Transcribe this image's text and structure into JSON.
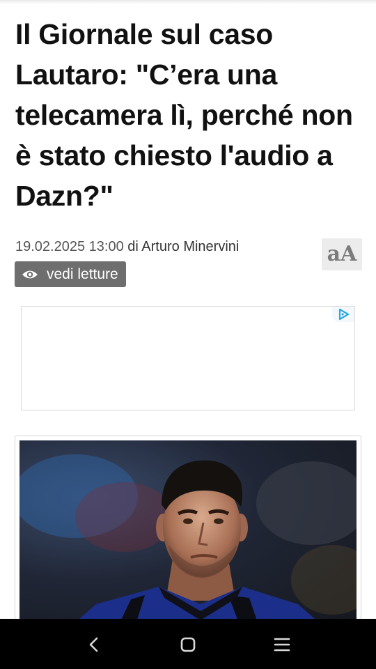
{
  "article": {
    "headline": "Il Giornale sul caso Lautaro: \"C’era una telecamera lì, perché non è stato chiesto l'audio a Dazn?\"",
    "date": "19.02.2025 13:00",
    "by_prefix": "di",
    "author": "Arturo Minervini",
    "font_size_label": "aA",
    "reads_label": "vedi letture"
  },
  "icons": {
    "reads": "eye-icon",
    "ad": "adchoices-icon",
    "nav_back": "back-chevron-icon",
    "nav_home": "home-square-icon",
    "nav_menu": "menu-lines-icon"
  },
  "colors": {
    "reads_button_bg": "#6e6e6e",
    "font_button_bg": "#ececec",
    "nav_bar_bg": "#000000"
  }
}
